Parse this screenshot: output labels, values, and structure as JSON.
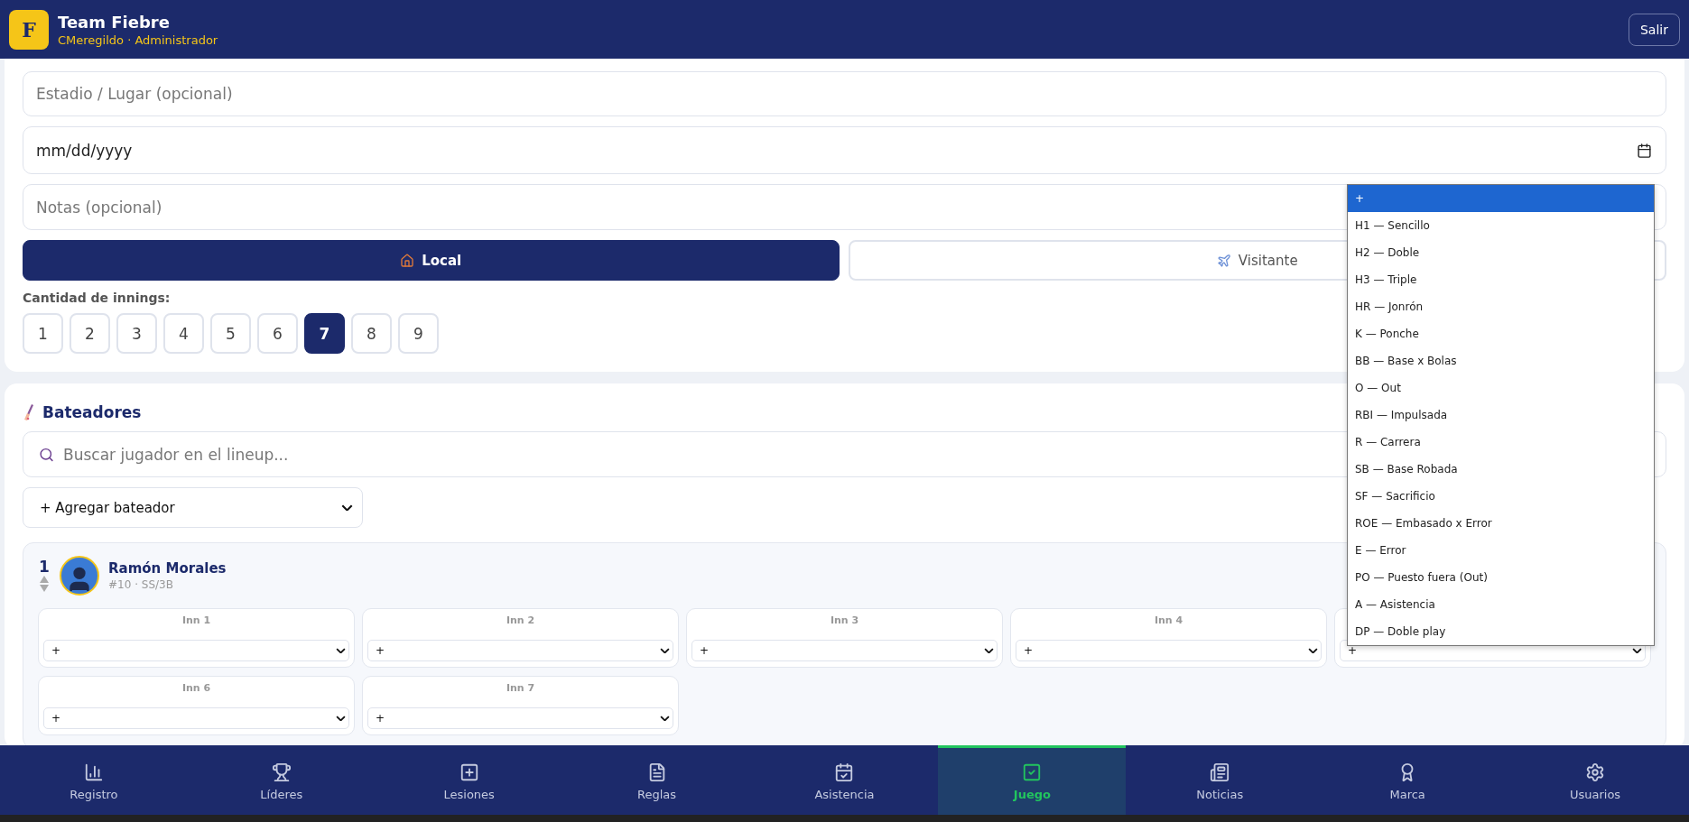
{
  "header": {
    "logo_letter": "F",
    "team": "Team Fiebre",
    "user": "CMeregildo · Administrador",
    "logout": "Salir"
  },
  "form": {
    "venue": {
      "placeholder": "Estadio / Lugar (opcional)"
    },
    "date": {
      "value": "mm/dd/yyyy"
    },
    "notes": {
      "placeholder": "Notas (opcional)"
    },
    "home_away": [
      {
        "label": "Local",
        "selected": true,
        "kind": "home"
      },
      {
        "label": "Visitante",
        "selected": false,
        "kind": "away"
      }
    ],
    "innings_label": "Cantidad de innings:",
    "innings_options": [
      {
        "label": "1",
        "selected": false
      },
      {
        "label": "2",
        "selected": false
      },
      {
        "label": "3",
        "selected": false
      },
      {
        "label": "4",
        "selected": false
      },
      {
        "label": "5",
        "selected": false
      },
      {
        "label": "6",
        "selected": false
      },
      {
        "label": "7",
        "selected": true
      },
      {
        "label": "8",
        "selected": false
      },
      {
        "label": "9",
        "selected": false
      }
    ]
  },
  "batters": {
    "title": "Bateadores",
    "search": {
      "placeholder": "Buscar jugador en el lineup..."
    },
    "add_select": "+ Agregar bateador",
    "players": [
      {
        "order": "1",
        "name": "Ramón Morales",
        "info": "#10 · SS/3B",
        "innings": [
          {
            "label": "Inn 1",
            "value": "+"
          },
          {
            "label": "Inn 2",
            "value": "+"
          },
          {
            "label": "Inn 3",
            "value": "+"
          },
          {
            "label": "Inn 4",
            "value": "+"
          },
          {
            "value": "+"
          },
          {
            "label": "Inn 6",
            "value": "+"
          },
          {
            "label": "Inn 7",
            "value": "+"
          }
        ]
      }
    ]
  },
  "dropdown": {
    "options": [
      {
        "label": "+",
        "selected": true
      },
      {
        "label": "H1 — Sencillo",
        "selected": false
      },
      {
        "label": "H2 — Doble",
        "selected": false
      },
      {
        "label": "H3 — Triple",
        "selected": false
      },
      {
        "label": "HR — Jonrón",
        "selected": false
      },
      {
        "label": "K — Ponche",
        "selected": false
      },
      {
        "label": "BB — Base x Bolas",
        "selected": false
      },
      {
        "label": "O — Out",
        "selected": false
      },
      {
        "label": "RBI — Impulsada",
        "selected": false
      },
      {
        "label": "R — Carrera",
        "selected": false
      },
      {
        "label": "SB — Base Robada",
        "selected": false
      },
      {
        "label": "SF — Sacrificio",
        "selected": false
      },
      {
        "label": "ROE — Embasado x Error",
        "selected": false
      },
      {
        "label": "E — Error",
        "selected": false
      },
      {
        "label": "PO — Puesto fuera (Out)",
        "selected": false
      },
      {
        "label": "A — Asistencia",
        "selected": false
      },
      {
        "label": "DP — Doble play",
        "selected": false
      }
    ]
  },
  "nav": [
    {
      "label": "Registro",
      "kind": "chart",
      "selected": false
    },
    {
      "label": "Líderes",
      "kind": "trophy",
      "selected": false
    },
    {
      "label": "Lesiones",
      "kind": "injury",
      "selected": false
    },
    {
      "label": "Reglas",
      "kind": "document",
      "selected": false
    },
    {
      "label": "Asistencia",
      "kind": "calendar",
      "selected": false
    },
    {
      "label": "Juego",
      "kind": "check",
      "selected": true
    },
    {
      "label": "Noticias",
      "kind": "news",
      "selected": false
    },
    {
      "label": "Marca",
      "kind": "award",
      "selected": false
    },
    {
      "label": "Usuarios",
      "kind": "settings",
      "selected": false
    }
  ]
}
